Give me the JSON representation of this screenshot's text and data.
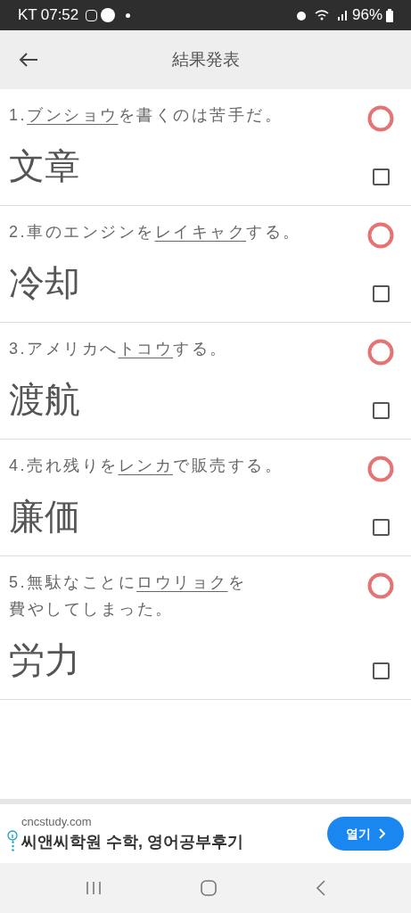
{
  "status_bar": {
    "carrier": "KT",
    "time": "07:52",
    "battery": "96%"
  },
  "app_bar": {
    "title": "結果発表"
  },
  "questions": [
    {
      "number": "1.",
      "reading": "ブンショウ",
      "after": "を書くのは苦手だ。",
      "answer": "文章",
      "correct": true,
      "checked": false
    },
    {
      "number": "2.",
      "before": "車のエンジンを",
      "reading": "レイキャク",
      "after": "する。",
      "answer": "冷却",
      "correct": true,
      "checked": false
    },
    {
      "number": "3.",
      "before": "アメリカへ",
      "reading": "トコウ",
      "after": "する。",
      "answer": "渡航",
      "correct": true,
      "checked": false
    },
    {
      "number": "4.",
      "before": "売れ残りを",
      "reading": "レンカ",
      "after": "で販売する。",
      "answer": "廉価",
      "correct": true,
      "checked": false
    },
    {
      "number": "5.",
      "before": "無駄なことに",
      "reading": "ロウリョク",
      "after": "を",
      "continuation": "費やしてしまった。",
      "answer": "労力",
      "correct": true,
      "checked": false
    }
  ],
  "ad": {
    "domain": "cncstudy.com",
    "headline": "씨앤씨학원 수학, 영어공부후기",
    "button": "열기"
  }
}
